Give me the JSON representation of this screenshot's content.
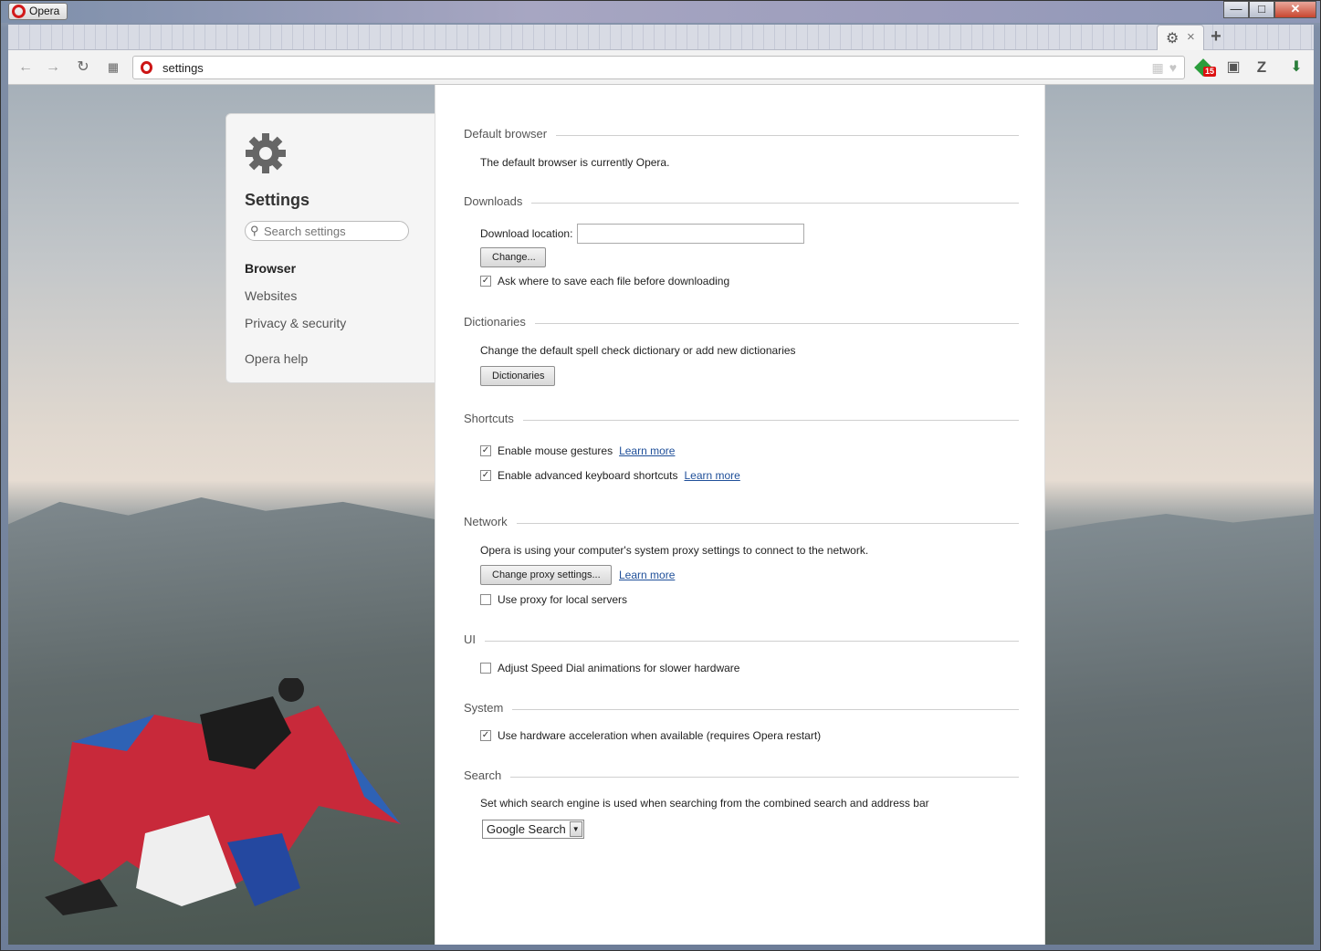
{
  "window": {
    "app_title": "Opera",
    "minimize": "—",
    "maximize": "□",
    "close": "✕"
  },
  "tabs": [
    {
      "icon": "gear-icon",
      "close": "×"
    }
  ],
  "newtab_label": "+",
  "toolbar": {
    "address": "settings"
  },
  "extensions": {
    "badge_count": "15",
    "z_label": "Z"
  },
  "sidebar": {
    "title": "Settings",
    "search_placeholder": "Search settings",
    "items": [
      "Browser",
      "Websites",
      "Privacy & security"
    ],
    "help": "Opera help"
  },
  "sections": {
    "default_browser": {
      "title": "Default browser",
      "text": "The default browser is currently Opera."
    },
    "downloads": {
      "title": "Downloads",
      "location_label": "Download location:",
      "location_value": "",
      "change_button": "Change...",
      "ask_checkbox": "Ask where to save each file before downloading",
      "ask_checked": true
    },
    "dictionaries": {
      "title": "Dictionaries",
      "text": "Change the default spell check dictionary or add new dictionaries",
      "button": "Dictionaries"
    },
    "shortcuts": {
      "title": "Shortcuts",
      "mouse": "Enable mouse gestures",
      "mouse_checked": true,
      "keyboard": "Enable advanced keyboard shortcuts",
      "keyboard_checked": true,
      "learn_more": "Learn more"
    },
    "network": {
      "title": "Network",
      "text": "Opera is using your computer's system proxy settings to connect to the network.",
      "proxy_button": "Change proxy settings...",
      "learn_more": "Learn more",
      "local_proxy": "Use proxy for local servers",
      "local_proxy_checked": false
    },
    "ui": {
      "title": "UI",
      "speed_dial": "Adjust Speed Dial animations for slower hardware",
      "speed_dial_checked": false
    },
    "system": {
      "title": "System",
      "hw_accel": "Use hardware acceleration when available (requires Opera restart)",
      "hw_accel_checked": true
    },
    "search": {
      "title": "Search",
      "text": "Set which search engine is used when searching from the combined search and address bar",
      "selected_engine": "Google Search"
    }
  },
  "colors": {
    "accent_red": "#cc1515",
    "link": "#1f4f99"
  }
}
